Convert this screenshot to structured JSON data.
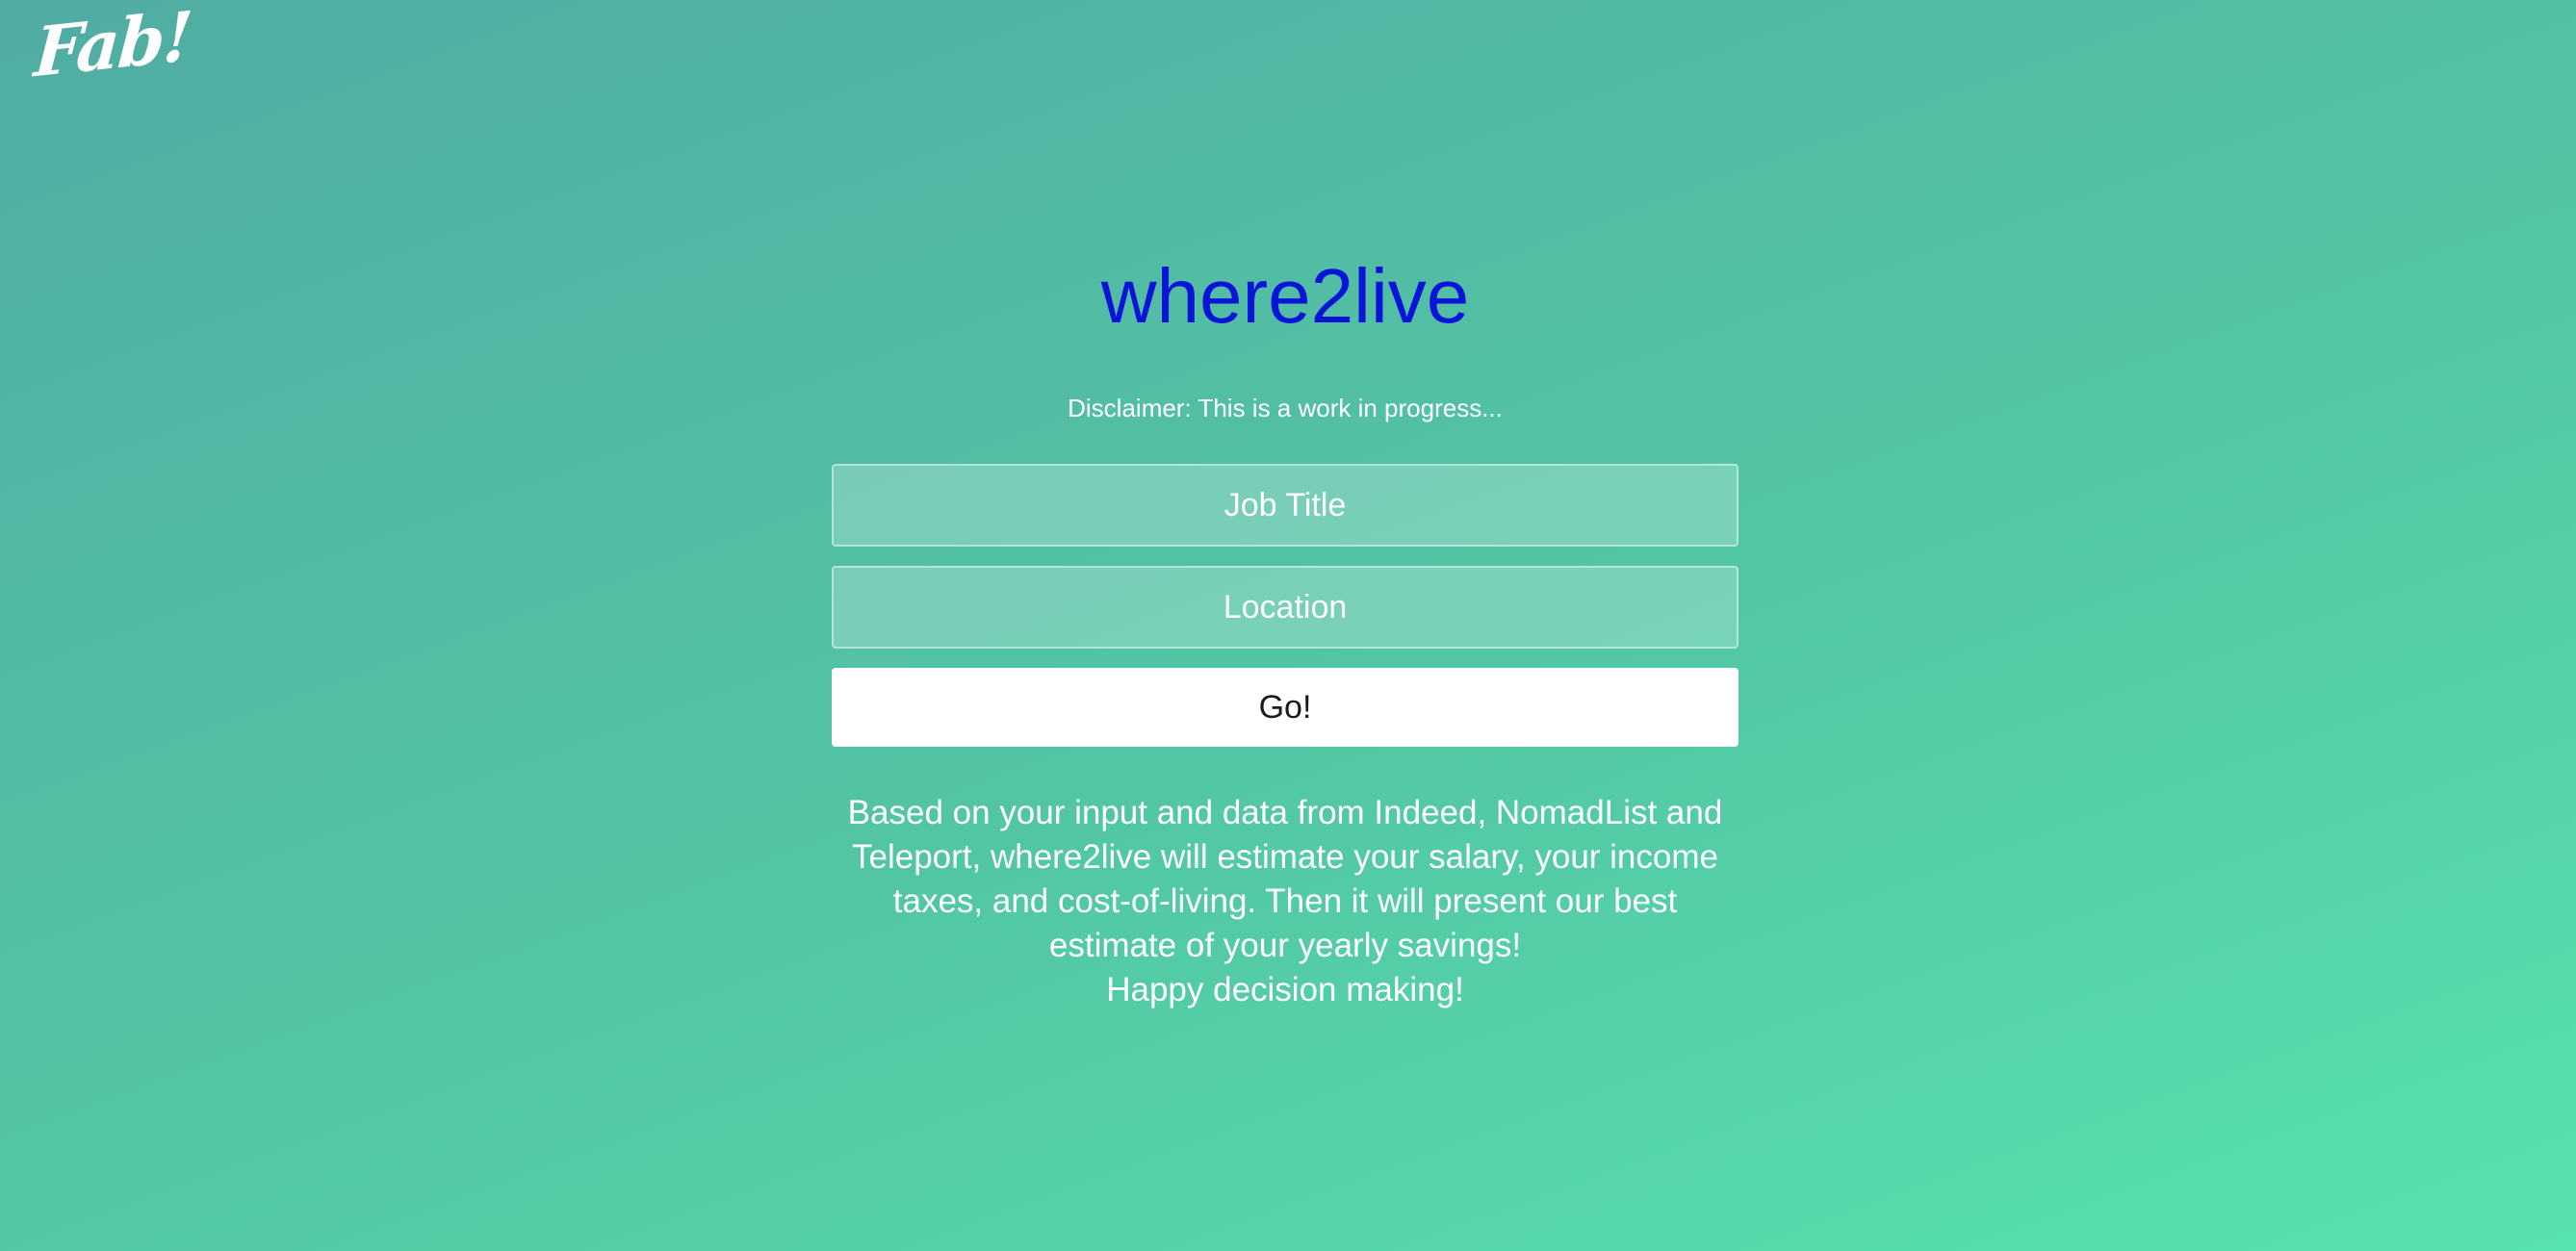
{
  "logo": {
    "text": "Fab!"
  },
  "header": {
    "title": "where2live",
    "title_color": "#0a14d8",
    "disclaimer": "Disclaimer: This is a work in progress..."
  },
  "form": {
    "job_title": {
      "placeholder": "Job Title",
      "value": ""
    },
    "location": {
      "placeholder": "Location",
      "value": ""
    },
    "submit_label": "Go!"
  },
  "description": {
    "body": "Based on your input and data from Indeed, NomadList and Teleport, where2live will estimate your salary, your income taxes, and cost-of-living. Then it will present our best estimate of your yearly savings!",
    "closing": "Happy decision making!"
  },
  "colors": {
    "background_start": "#51aca3",
    "background_end": "#58e2ad",
    "text": "#ffffff",
    "button_background": "#ffffff"
  }
}
